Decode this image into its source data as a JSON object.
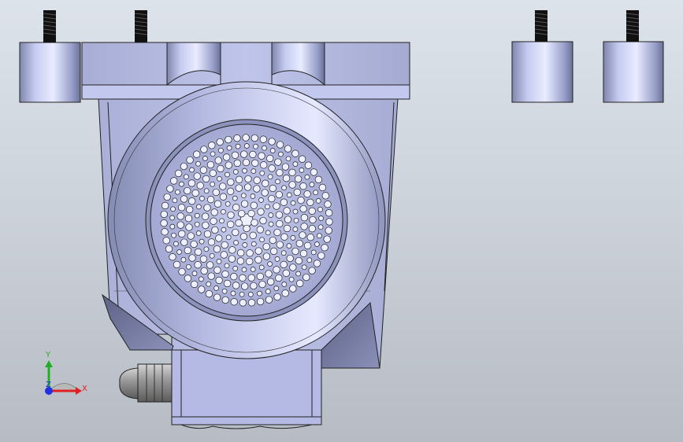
{
  "viewport": {
    "background_top": "#dde3ea",
    "background_bottom": "#b7bcc4"
  },
  "model": {
    "part_color": "#b9bfe6",
    "edge_color": "#1a1a1a"
  },
  "triad": {
    "x_label": "X",
    "y_label": "Y",
    "z_label": "Z",
    "x_color": "#e02020",
    "y_color": "#20b020",
    "z_color": "#2030e0"
  }
}
